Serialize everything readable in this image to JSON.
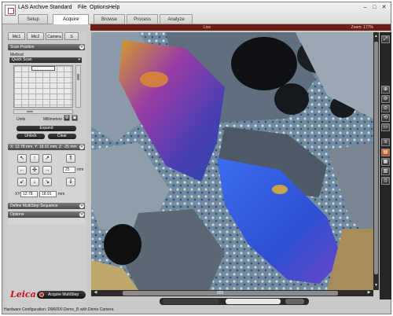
{
  "app": {
    "title": "LAS Archive Standard",
    "menus": [
      "File",
      "Options",
      "Help"
    ]
  },
  "workflow_tabs": [
    "Setup",
    "Acquire",
    "Browse",
    "Process",
    "Analyze"
  ],
  "active_tab": "Acquire",
  "live_label": "Live",
  "zoom_label": "Zoom: 177%",
  "module_tabs": [
    "Mic1",
    "Mic2",
    "Camera",
    "S"
  ],
  "scan_position": {
    "title": "Scan Position",
    "method_label": "Method",
    "method_value": "Quick Scan",
    "units_label": "Units",
    "units_value": "Millimeters",
    "expand": "Expand",
    "unlock": "Unlock",
    "clear": "Clear"
  },
  "xy": {
    "title": "X: 12.78 mm, Y: 18.91 mm, Z: -25 mm",
    "z_value": "25",
    "z_unit": "mm",
    "x_value": "12.78",
    "y_value": "18.91",
    "xy_label": "XY",
    "xy_unit": "mm"
  },
  "sections": {
    "multistep": "Define MultiStep Sequence",
    "options": "Options"
  },
  "logo_text": "Leica",
  "acquire_button": "Acquire MultiStep",
  "hscroll_label": "888",
  "status_text": "Hardware Configuration: DM6000 Demo_B with Demo Camera",
  "colors": {
    "accent": "#6d1d14",
    "record": "#cf2b1f",
    "logo": "#c3141d"
  },
  "icons": [
    "grid-icon",
    "zoom-in-icon",
    "zoom-out-icon",
    "fit-icon",
    "overlay-icon",
    "histogram-icon",
    "layout-icon"
  ]
}
